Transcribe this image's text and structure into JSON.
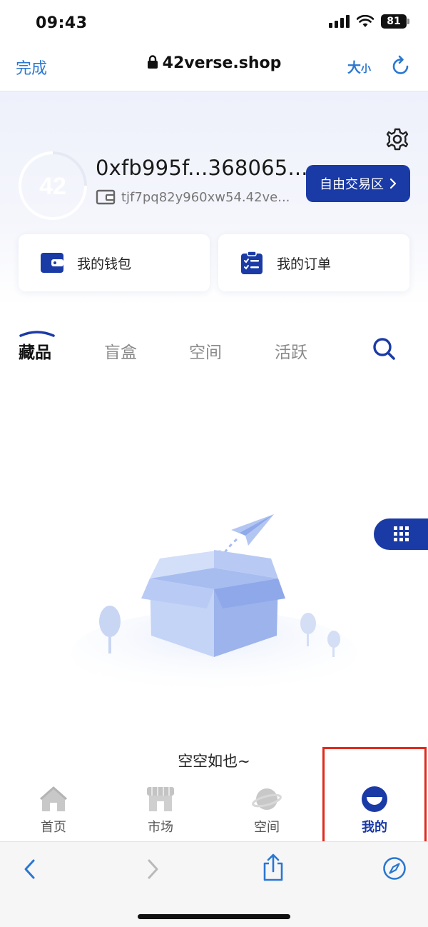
{
  "status_bar": {
    "time": "09:43",
    "battery": "81"
  },
  "browser": {
    "done_label": "完成",
    "url": "42verse.shop",
    "text_size_big": "大",
    "text_size_small": "小"
  },
  "profile": {
    "address": "0xfb995f...368065...",
    "sub_address": "tjf7pq82y960xw54.42ve...",
    "trade_button": "自由交易区"
  },
  "quick_actions": [
    {
      "label": "我的钱包",
      "icon": "wallet-icon"
    },
    {
      "label": "我的订单",
      "icon": "order-list-icon"
    }
  ],
  "tabs": [
    {
      "label": "藏品",
      "active": true
    },
    {
      "label": "盲盒",
      "active": false
    },
    {
      "label": "空间",
      "active": false
    },
    {
      "label": "活跃",
      "active": false
    }
  ],
  "empty_state": {
    "text": "空空如也~"
  },
  "bottom_nav": [
    {
      "label": "首页",
      "icon": "home-icon",
      "active": false
    },
    {
      "label": "市场",
      "icon": "market-icon",
      "active": false
    },
    {
      "label": "空间",
      "icon": "planet-icon",
      "active": false
    },
    {
      "label": "我的",
      "icon": "profile-smile-icon",
      "active": true
    }
  ],
  "colors": {
    "brand": "#1a3aa6",
    "link": "#2b77d1",
    "highlight": "#e02a1c"
  }
}
